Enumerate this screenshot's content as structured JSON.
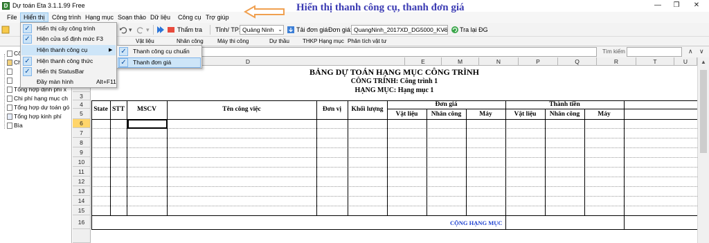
{
  "window": {
    "title": "Dự toán Eta 3.1.1.99 Free",
    "controls": {
      "minimize": "—",
      "maximize": "❐",
      "close": "✕"
    }
  },
  "menubar": {
    "items": [
      "File",
      "Hiển thị",
      "Công trình",
      "Hạng mục",
      "Soạn thảo",
      "Dữ liệu",
      "Công cụ",
      "Trợ giúp"
    ],
    "active": "Hiển thị"
  },
  "annotation": {
    "text": "Hiển thị thanh công cụ, thanh đơn giá",
    "color": "#3b3bb3",
    "arrow_color": "#f0a050"
  },
  "toolbar": {
    "tham_tra": "Thẩm tra",
    "tinh_tp_label": "Tỉnh/ TP:",
    "tinh_tp_value": "Quảng Ninh",
    "tai_don_gia": "Tải đơn giá",
    "don_gia_label": "Đơn giá:",
    "don_gia_value": "QuangNinh_2017XD_DG5000_KV6",
    "tra_lai": "Tra lại ĐG"
  },
  "price_toolbar": {
    "items": [
      "Vật liệu",
      "Nhân công",
      "Máy thi công",
      "Dự thầu",
      "THKP Hạng mục",
      "Phân tích vật tư"
    ]
  },
  "search": {
    "label": "Tìm kiếm",
    "value": ""
  },
  "tree": {
    "items": [
      "Cô",
      "Ch",
      "",
      "",
      "Tổng hợp định phí x",
      "Chi phí hạng mục ch",
      "Tổng hợp dự toán gó",
      "Tổng hợp kinh phí",
      "Bìa"
    ]
  },
  "view_menu": {
    "items": [
      {
        "label": "Hiển thị cây công trình",
        "shortcut": "",
        "checked": true,
        "submenu": false
      },
      {
        "label": "Hiện cửa sổ định mức",
        "shortcut": "F3",
        "checked": true,
        "submenu": false
      },
      {
        "label": "Hiện thanh công cụ",
        "shortcut": "",
        "checked": false,
        "submenu": true
      },
      {
        "label": "Hiện thanh công thức",
        "shortcut": "",
        "checked": true,
        "submenu": false
      },
      {
        "label": "Hiển thị StatusBar",
        "shortcut": "",
        "checked": true,
        "submenu": false
      },
      {
        "label": "Đầy màn hình",
        "shortcut": "Alt+F11",
        "checked": false,
        "submenu": false
      }
    ],
    "highlighted_index": 2
  },
  "toolbar_submenu": {
    "items": [
      {
        "label": "Thanh công cụ chuẩn",
        "checked": true
      },
      {
        "label": "Thanh đơn giá",
        "checked": true
      }
    ],
    "highlighted_index": 1
  },
  "sheet": {
    "columns": [
      "D",
      "E",
      "M",
      "N",
      "P",
      "Q",
      "R",
      "T",
      "U"
    ],
    "rows": [
      "3",
      "4",
      "5",
      "6",
      "7",
      "8",
      "9",
      "10",
      "11",
      "12",
      "13",
      "14",
      "15",
      "16"
    ],
    "selected_row": "6",
    "title": "BẢNG DỰ TOÁN HẠNG MỤC CÔNG TRÌNH",
    "subtitle1": "CÔNG TRÌNH: Công trình 1",
    "subtitle2": "HẠNG MỤC: Hạng mục 1",
    "headers": {
      "state": "State",
      "stt": "STT",
      "mscv": "MSCV",
      "ten_cong_viec": "Tên công việc",
      "don_vi": "Đơn vị",
      "khoi_luong": "Khối lượng",
      "don_gia": "Đơn giá",
      "thanh_tien": "Thành tiền",
      "vat_lieu": "Vật liệu",
      "nhan_cong": "Nhân công",
      "may": "Máy"
    },
    "total_label": "CỘNG HẠNG MỤC"
  }
}
